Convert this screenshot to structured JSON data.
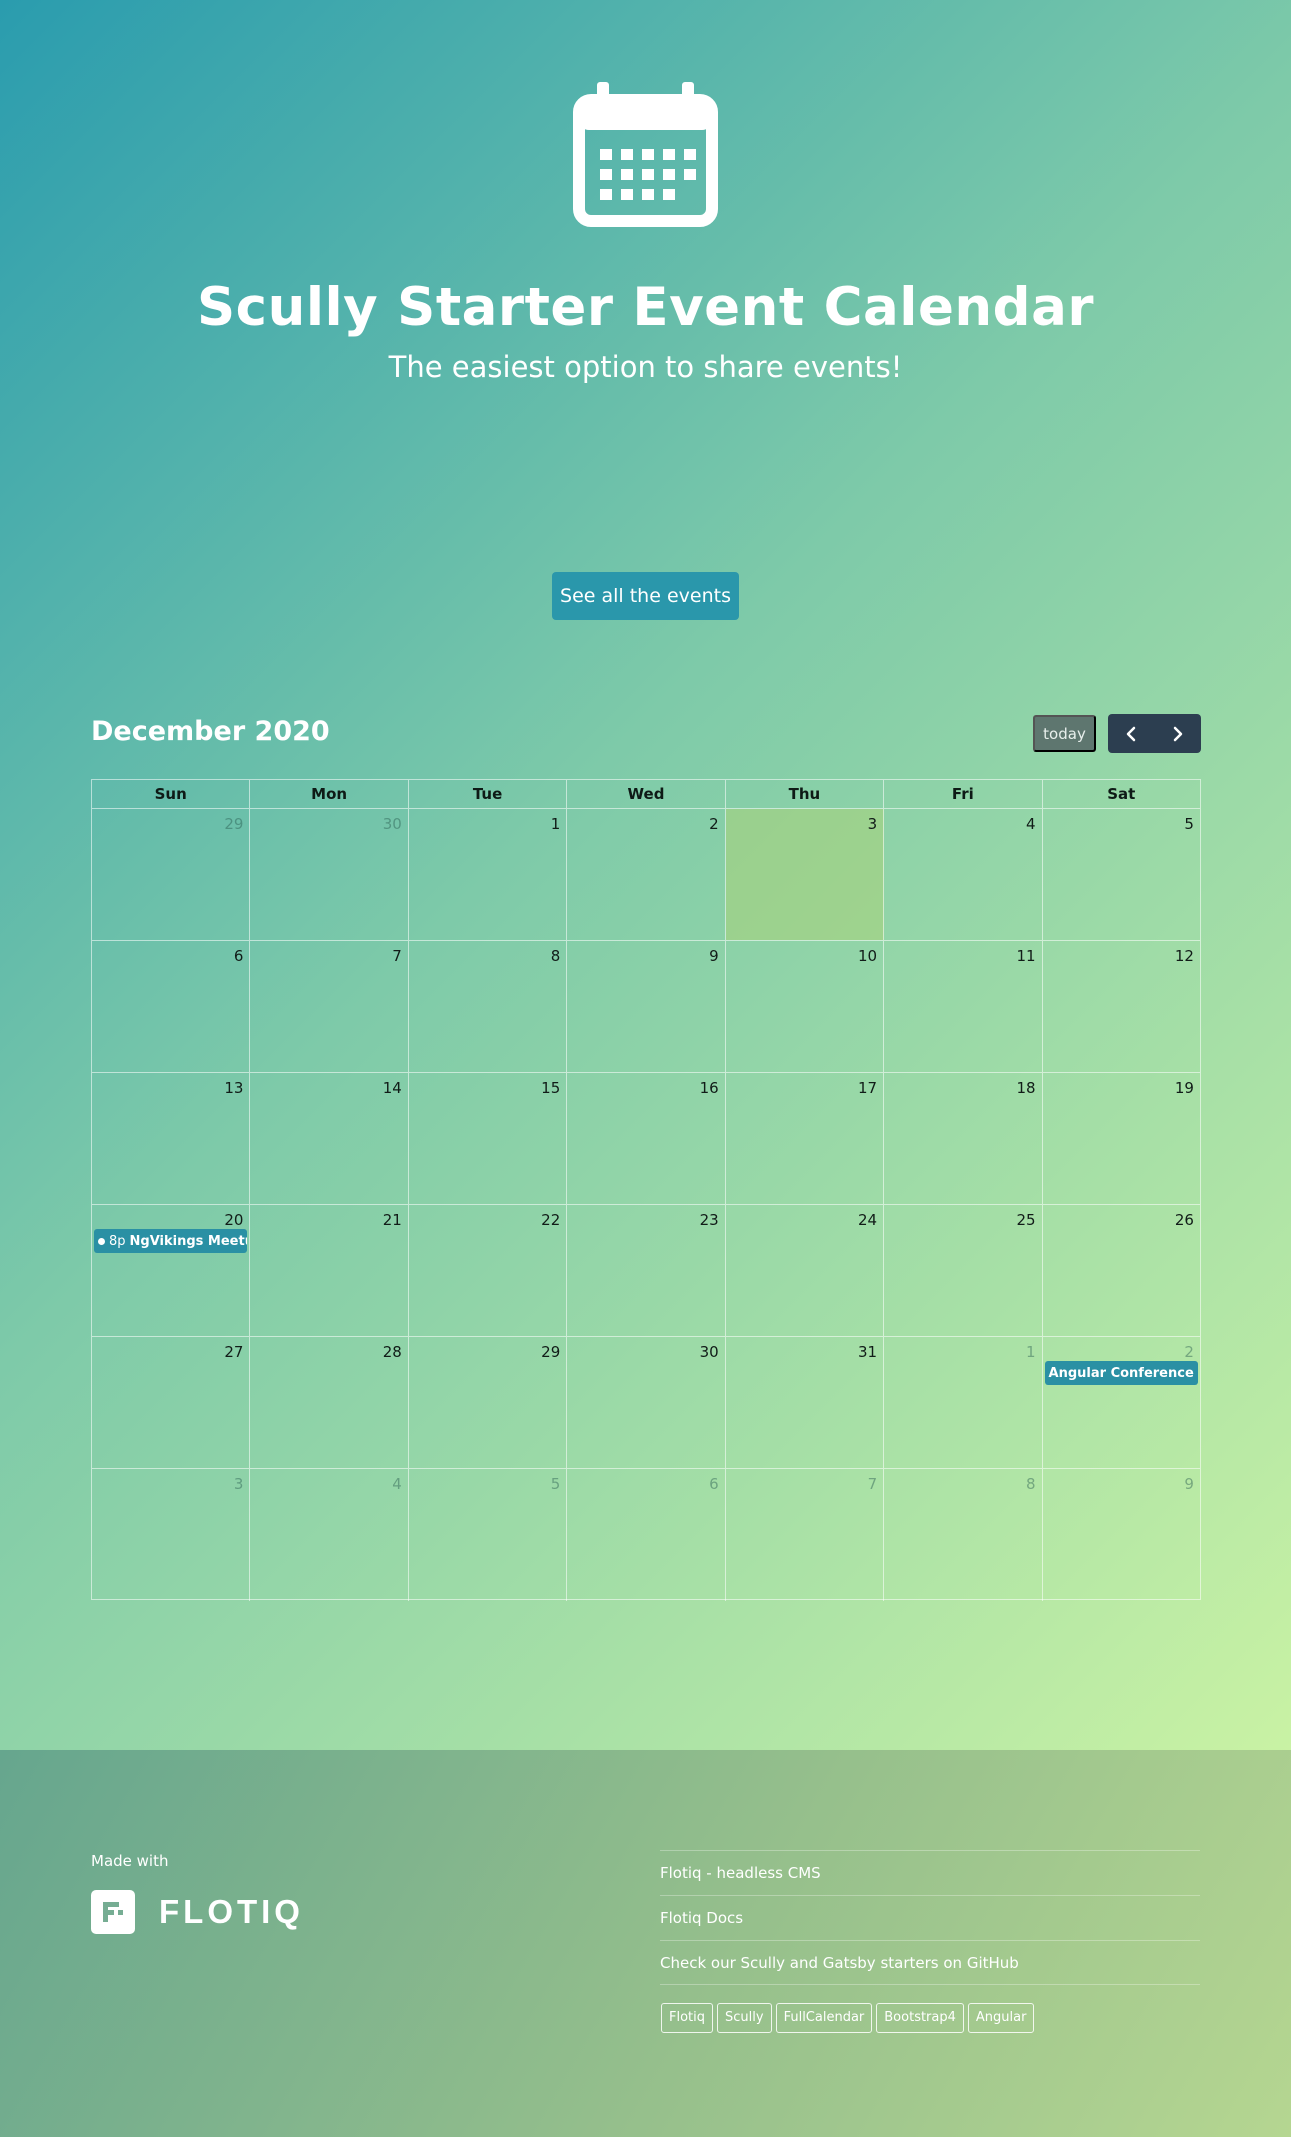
{
  "hero": {
    "icon": "calendar-icon",
    "title": "Scully Starter Event Calendar",
    "subtitle": "The easiest option to share events!",
    "cta_label": "See all the events"
  },
  "calendar": {
    "title": "December 2020",
    "today_label": "today",
    "prev_icon": "chevron-left-icon",
    "next_icon": "chevron-right-icon",
    "weekdays": [
      "Sun",
      "Mon",
      "Tue",
      "Wed",
      "Thu",
      "Fri",
      "Sat"
    ],
    "weeks": [
      [
        {
          "d": "29",
          "other": true
        },
        {
          "d": "30",
          "other": true
        },
        {
          "d": "1"
        },
        {
          "d": "2"
        },
        {
          "d": "3",
          "today": true
        },
        {
          "d": "4"
        },
        {
          "d": "5"
        }
      ],
      [
        {
          "d": "6"
        },
        {
          "d": "7"
        },
        {
          "d": "8"
        },
        {
          "d": "9"
        },
        {
          "d": "10"
        },
        {
          "d": "11"
        },
        {
          "d": "12"
        }
      ],
      [
        {
          "d": "13"
        },
        {
          "d": "14"
        },
        {
          "d": "15"
        },
        {
          "d": "16"
        },
        {
          "d": "17"
        },
        {
          "d": "18"
        },
        {
          "d": "19"
        }
      ],
      [
        {
          "d": "20",
          "event": {
            "time": "8p",
            "title": "NgVikings Meetup",
            "dot": true
          }
        },
        {
          "d": "21"
        },
        {
          "d": "22"
        },
        {
          "d": "23"
        },
        {
          "d": "24"
        },
        {
          "d": "25"
        },
        {
          "d": "26"
        }
      ],
      [
        {
          "d": "27"
        },
        {
          "d": "28"
        },
        {
          "d": "29"
        },
        {
          "d": "30"
        },
        {
          "d": "31"
        },
        {
          "d": "1",
          "other": true
        },
        {
          "d": "2",
          "other": true,
          "event": {
            "title": "Angular Conference Sid"
          }
        }
      ],
      [
        {
          "d": "3",
          "other": true
        },
        {
          "d": "4",
          "other": true
        },
        {
          "d": "5",
          "other": true
        },
        {
          "d": "6",
          "other": true
        },
        {
          "d": "7",
          "other": true
        },
        {
          "d": "8",
          "other": true
        },
        {
          "d": "9",
          "other": true
        }
      ]
    ],
    "colors": {
      "today_bg": "#a8d27c",
      "event_bg": "#2a90a4",
      "nav_bg": "#2c3e50"
    }
  },
  "footer": {
    "made_with": "Made with",
    "brand": "FLOTIQ",
    "links": [
      "Flotiq - headless CMS",
      "Flotiq Docs",
      "Check our Scully and Gatsby starters on GitHub"
    ],
    "tags": [
      "Flotiq",
      "Scully",
      "FullCalendar",
      "Bootstrap4",
      "Angular"
    ]
  }
}
